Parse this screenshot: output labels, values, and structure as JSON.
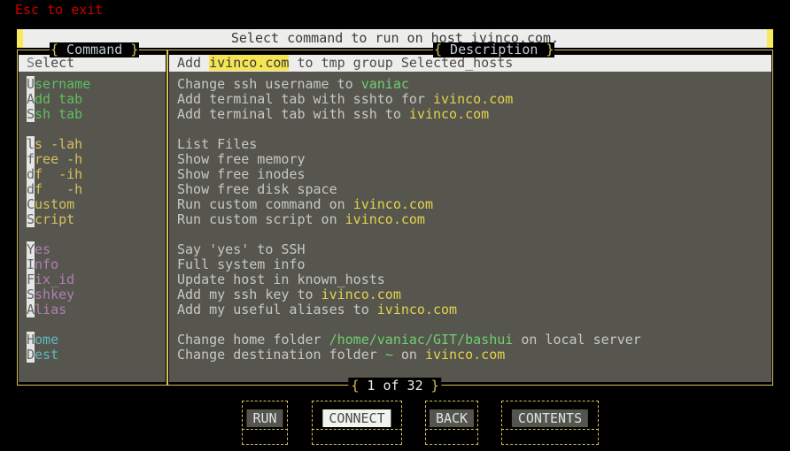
{
  "hint": {
    "esc_text": "Esc to exit"
  },
  "title": {
    "text": "Select command to run on host ivinco.com."
  },
  "panels": {
    "command": {
      "title_open": "{",
      "title_label": " Command ",
      "title_close": "}",
      "header": {
        "hotkey": "S",
        "rest": "elect"
      },
      "items": [
        {
          "hotkey": "U",
          "rest": "sername",
          "color": "green"
        },
        {
          "hotkey": "A",
          "rest": "dd tab",
          "color": "green"
        },
        {
          "hotkey": "S",
          "rest": "sh tab",
          "color": "green"
        },
        {
          "blank": true
        },
        {
          "hotkey": "l",
          "rest": "s -lah",
          "color": "yellow"
        },
        {
          "hotkey": "f",
          "rest": "ree -h",
          "color": "yellow"
        },
        {
          "hotkey": "d",
          "rest": "f  -ih",
          "color": "yellow"
        },
        {
          "hotkey": "d",
          "rest": "f   -h",
          "color": "yellow"
        },
        {
          "hotkey": "C",
          "rest": "ustom",
          "color": "yellow"
        },
        {
          "hotkey": "S",
          "rest": "cript",
          "color": "yellow"
        },
        {
          "blank": true
        },
        {
          "hotkey": "Y",
          "rest": "es",
          "color": "purple"
        },
        {
          "hotkey": "I",
          "rest": "nfo",
          "color": "purple"
        },
        {
          "hotkey": "F",
          "rest": "ix_id",
          "color": "purple"
        },
        {
          "hotkey": "S",
          "rest": "shkey",
          "color": "purple"
        },
        {
          "hotkey": "A",
          "rest": "lias",
          "color": "purple"
        },
        {
          "blank": true
        },
        {
          "hotkey": "H",
          "rest": "ome",
          "color": "cyan"
        },
        {
          "hotkey": "D",
          "rest": "est",
          "color": "cyan"
        }
      ]
    },
    "description": {
      "title_open": "{",
      "title_label": " Description ",
      "title_close": "}",
      "header": {
        "pre": "Add ",
        "highlight": "ivinco.com",
        "post": " to tmp group Selected_hosts"
      },
      "items": [
        {
          "segments": [
            {
              "t": "Change ssh username to ",
              "c": "text"
            },
            {
              "t": "vaniac",
              "c": "user"
            }
          ]
        },
        {
          "segments": [
            {
              "t": "Add terminal tab with sshto for ",
              "c": "text"
            },
            {
              "t": "ivinco.com",
              "c": "host"
            }
          ]
        },
        {
          "segments": [
            {
              "t": "Add terminal tab with ssh to ",
              "c": "text"
            },
            {
              "t": "ivinco.com",
              "c": "host"
            }
          ]
        },
        {
          "blank": true
        },
        {
          "segments": [
            {
              "t": "List Files",
              "c": "text"
            }
          ]
        },
        {
          "segments": [
            {
              "t": "Show free memory",
              "c": "text"
            }
          ]
        },
        {
          "segments": [
            {
              "t": "Show free inodes",
              "c": "text"
            }
          ]
        },
        {
          "segments": [
            {
              "t": "Show free disk space",
              "c": "text"
            }
          ]
        },
        {
          "segments": [
            {
              "t": "Run custom command on ",
              "c": "text"
            },
            {
              "t": "ivinco.com",
              "c": "host"
            }
          ]
        },
        {
          "segments": [
            {
              "t": "Run custom script on ",
              "c": "text"
            },
            {
              "t": "ivinco.com",
              "c": "host"
            }
          ]
        },
        {
          "blank": true
        },
        {
          "segments": [
            {
              "t": "Say 'yes' to SSH",
              "c": "text"
            }
          ]
        },
        {
          "segments": [
            {
              "t": "Full system info",
              "c": "text"
            }
          ]
        },
        {
          "segments": [
            {
              "t": "Update host in known_hosts",
              "c": "text"
            }
          ]
        },
        {
          "segments": [
            {
              "t": "Add my ssh key to ",
              "c": "text"
            },
            {
              "t": "ivinco.com",
              "c": "host"
            }
          ]
        },
        {
          "segments": [
            {
              "t": "Add my useful aliases to ",
              "c": "text"
            },
            {
              "t": "ivinco.com",
              "c": "host"
            }
          ]
        },
        {
          "blank": true
        },
        {
          "segments": [
            {
              "t": "Change home folder ",
              "c": "text"
            },
            {
              "t": "/home/vaniac/GIT/bashui",
              "c": "path"
            },
            {
              "t": " on local server",
              "c": "text"
            }
          ]
        },
        {
          "segments": [
            {
              "t": "Change destination folder ",
              "c": "text"
            },
            {
              "t": "~",
              "c": "path"
            },
            {
              "t": " on ",
              "c": "text"
            },
            {
              "t": "ivinco.com",
              "c": "host"
            }
          ]
        }
      ]
    }
  },
  "counter": {
    "open": "{",
    "text": " 1 of 32 ",
    "close": "}"
  },
  "buttons": [
    {
      "label": "RUN",
      "active": false
    },
    {
      "label": "CONNECT",
      "active": true
    },
    {
      "label": "BACK",
      "active": false
    },
    {
      "label": "CONTENTS",
      "active": false
    }
  ],
  "colors": {
    "border_yellow": "#d8c35c",
    "panel_bg": "#56564f",
    "header_bg": "#ededeb",
    "highlight_yellow": "#f5e453",
    "esc_red": "#cc0000",
    "host_yellow": "#e4d24b",
    "user_green": "#6fd06f"
  }
}
